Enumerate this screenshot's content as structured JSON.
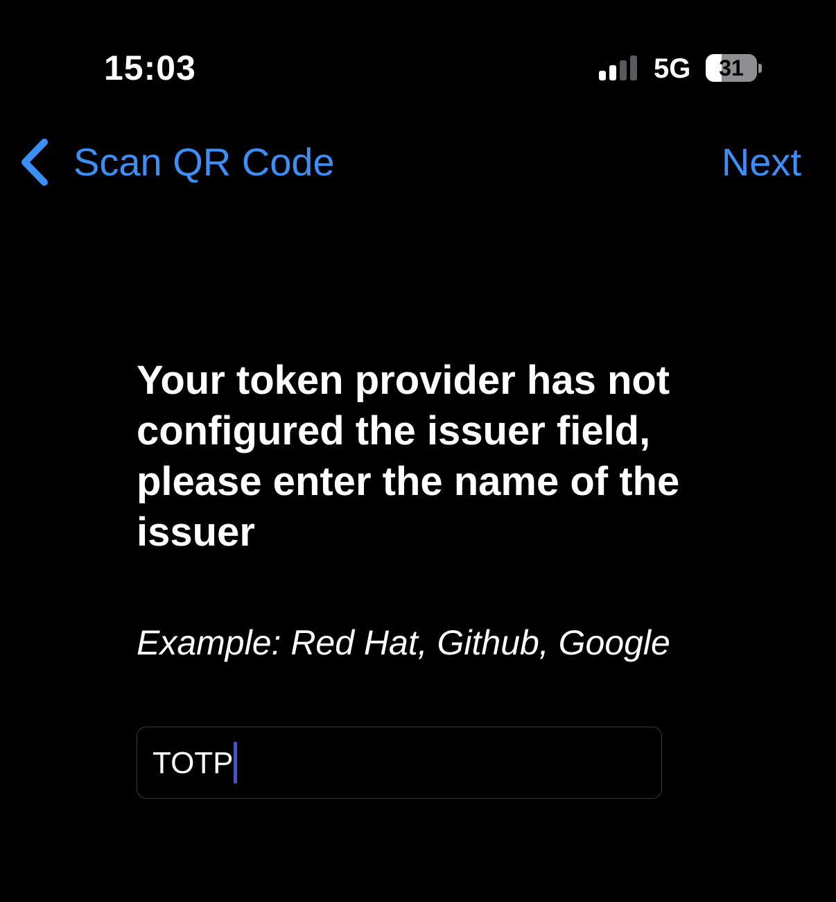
{
  "status_bar": {
    "time": "15:03",
    "network": "5G",
    "signal_bars_active": 2,
    "signal_bars_total": 4,
    "battery_level": "31",
    "battery_fraction": 0.31
  },
  "nav": {
    "back_icon": "chevron-left-icon",
    "back_label": "Scan QR Code",
    "next_label": "Next"
  },
  "content": {
    "instruction": "Your token provider has not configured the issuer field, please enter the name of the issuer",
    "example": "Example: Red Hat, Github, Google"
  },
  "issuer_input": {
    "value": "TOTP"
  },
  "colors": {
    "background": "#000000",
    "accent": "#3b8ff7",
    "caret": "#3d56d9",
    "text": "#ffffff",
    "input_border": "#3a3a3c"
  }
}
